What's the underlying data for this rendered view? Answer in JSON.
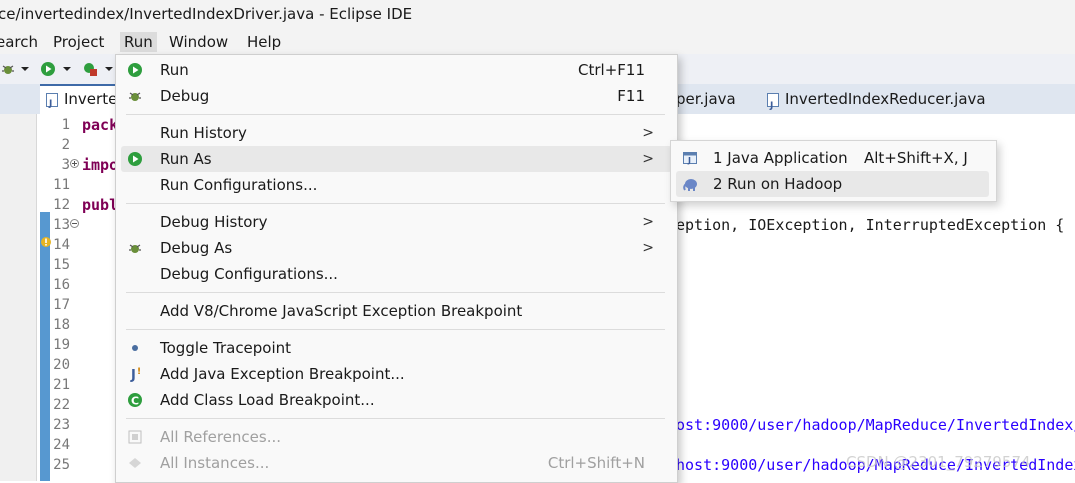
{
  "window": {
    "title": "ce/invertedindex/InvertedIndexDriver.java - Eclipse IDE"
  },
  "menubar": [
    "earch",
    "Project",
    "Run",
    "Window",
    "Help"
  ],
  "tabs": [
    {
      "label": "Inverte"
    },
    {
      "label": "per.java"
    },
    {
      "label": "InvertedIndexReducer.java"
    }
  ],
  "line_numbers": [
    "1",
    "2",
    "3",
    "11",
    "12",
    "13",
    "14",
    "15",
    "16",
    "17",
    "18",
    "19",
    "20",
    "21",
    "22",
    "23",
    "24",
    "25"
  ],
  "code": {
    "l1": "pack",
    "l3": "impo",
    "l12": "publ",
    "l13": "eption, IOException, InterruptedException {",
    "l24": "ost:9000/user/hadoop/MapReduce/InvertedIndex/",
    "l25": "host:9000/user/hadoop/MapReduce/InvertedIndex"
  },
  "run_menu": {
    "run": {
      "label": "Run",
      "accel": "Ctrl+F11"
    },
    "debug": {
      "label": "Debug",
      "accel": "F11"
    },
    "run_history": {
      "label": "Run History"
    },
    "run_as": {
      "label": "Run As"
    },
    "run_configurations": {
      "label": "Run Configurations..."
    },
    "debug_history": {
      "label": "Debug History"
    },
    "debug_as": {
      "label": "Debug As"
    },
    "debug_configurations": {
      "label": "Debug Configurations..."
    },
    "add_v8": {
      "label": "Add V8/Chrome JavaScript Exception Breakpoint"
    },
    "toggle_tracepoint": {
      "label": "Toggle Tracepoint"
    },
    "add_java_exception": {
      "label": "Add Java Exception Breakpoint..."
    },
    "add_class_load": {
      "label": "Add Class Load Breakpoint..."
    },
    "all_references": {
      "label": "All References..."
    },
    "all_instances": {
      "label": "All Instances...",
      "accel": "Ctrl+Shift+N"
    },
    "submenu_arrow": ">"
  },
  "run_as_submenu": [
    {
      "label": "1 Java Application",
      "accel": "Alt+Shift+X, J"
    },
    {
      "label": "2 Run on Hadoop",
      "accel": ""
    }
  ],
  "watermark": "CSDN @2301_79279574",
  "colors": {
    "keyword": "#7f0055",
    "string": "#2a00ff",
    "menu_hover": "#e8e8e8",
    "run_green": "#2e9e3e"
  }
}
